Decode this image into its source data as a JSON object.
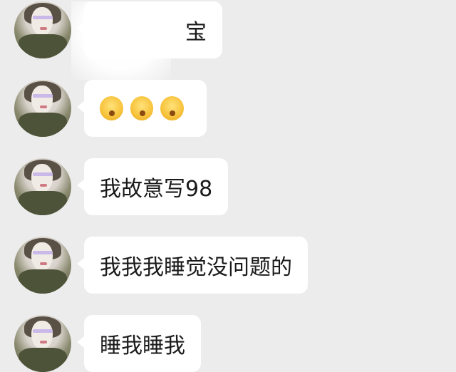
{
  "messages": [
    {
      "text": "宝",
      "emoji": []
    },
    {
      "text": "",
      "emoji": [
        "🙈",
        "🙈",
        "🙈"
      ]
    },
    {
      "text": "我故意写98",
      "emoji": []
    },
    {
      "text": "我我我睡觉没问题的",
      "emoji": []
    },
    {
      "text": "睡我睡我",
      "emoji": []
    }
  ]
}
